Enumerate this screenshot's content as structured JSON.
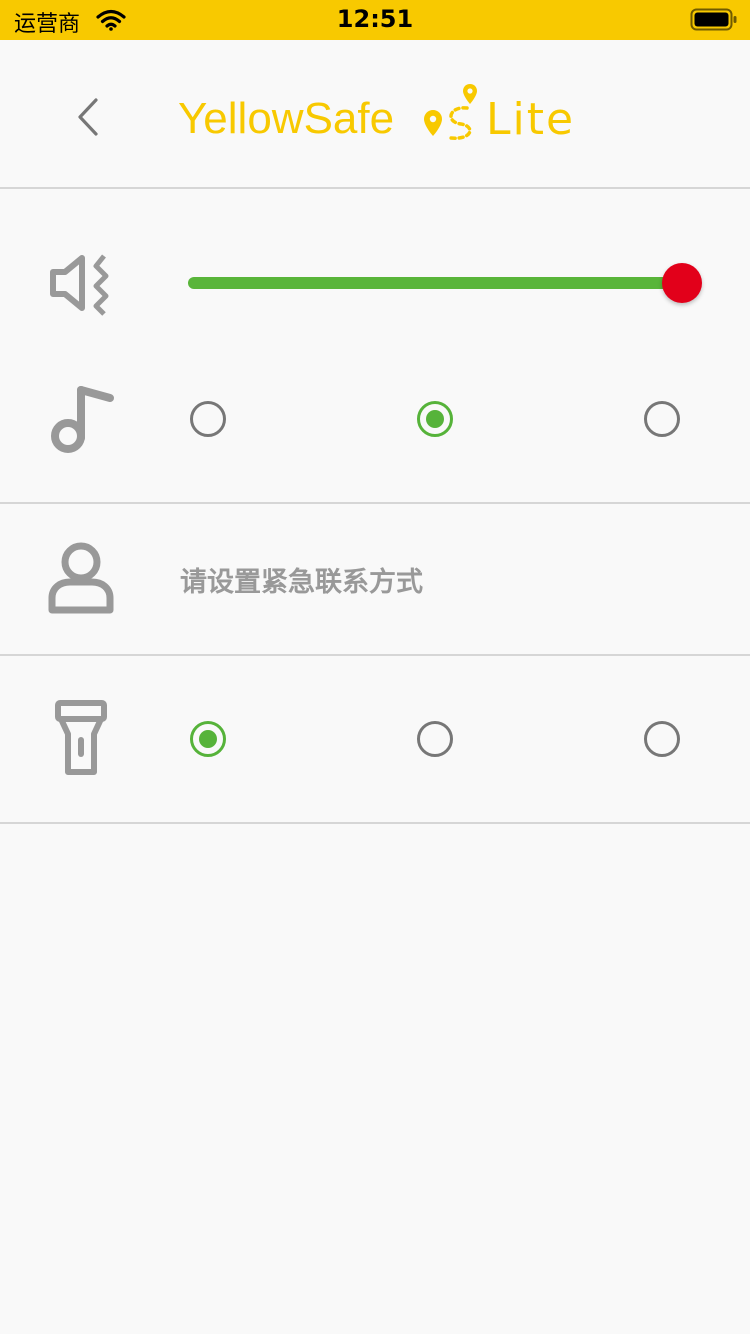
{
  "status_bar": {
    "carrier": "运营商",
    "time": "12:51",
    "background_color": "#f8c900",
    "wifi_icon": "wifi-icon",
    "battery_icon": "battery-icon"
  },
  "header": {
    "back_icon": "chevron-left-icon",
    "logo": {
      "text": "YellowSafe",
      "suffix": "Lite",
      "color": "#f8c900"
    }
  },
  "settings": {
    "volume": {
      "icon": "volume-vibrate-icon",
      "level": 1.0,
      "track_color": "#59b53a",
      "thumb_color": "#e2001a"
    },
    "ringtone": {
      "icon": "music-note-icon",
      "options_count": 3,
      "selected_index": 1
    },
    "contact": {
      "icon": "person-icon",
      "label": "请设置紧急联系方式"
    },
    "flashlight": {
      "icon": "flashlight-icon",
      "options_count": 3,
      "selected_index": 0
    }
  },
  "colors": {
    "selected": "#56b33a",
    "unselected": "#777777",
    "icon_gray": "#999999",
    "divider": "#d6d6d6"
  }
}
